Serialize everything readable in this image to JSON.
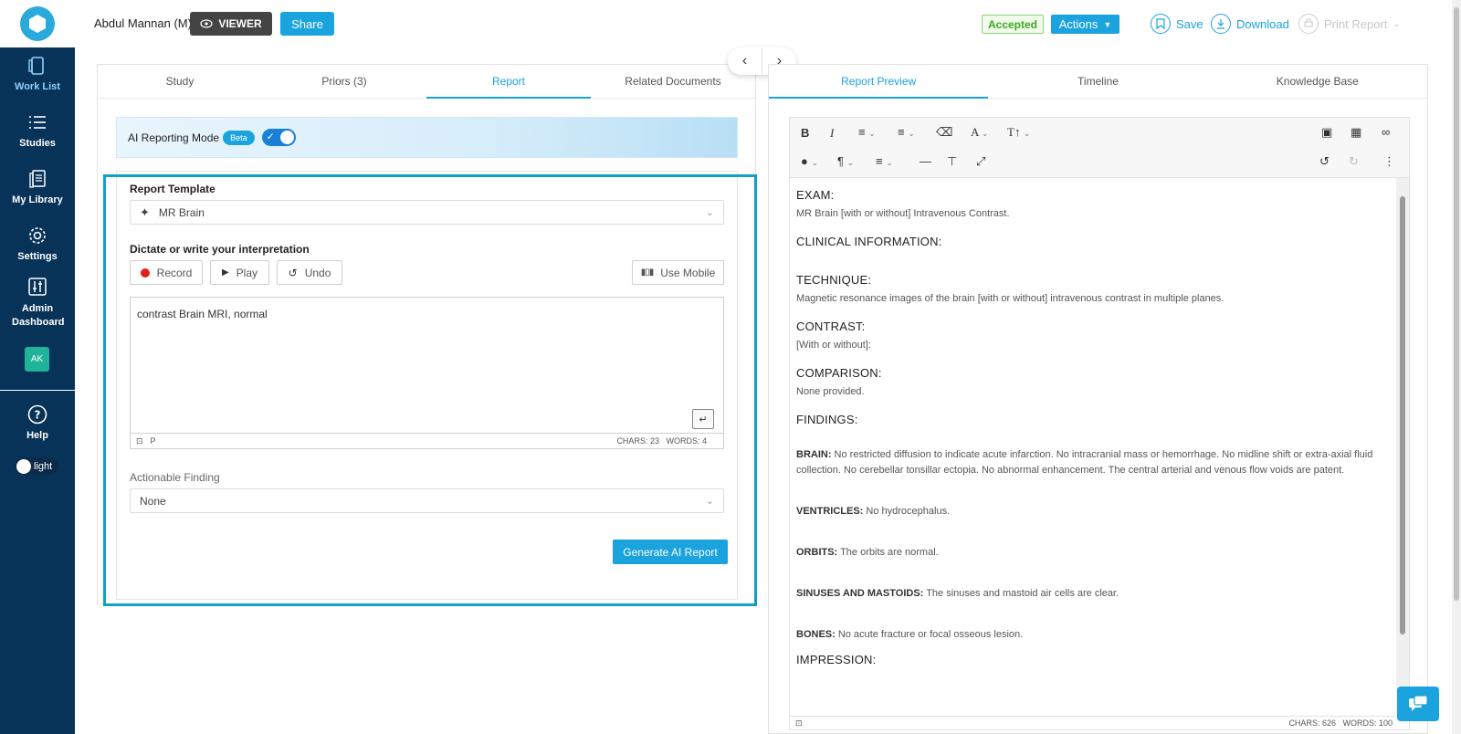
{
  "sidebar": {
    "items": [
      {
        "label": "Work List",
        "icon": "worklist-icon"
      },
      {
        "label": "Studies",
        "icon": "list-icon"
      },
      {
        "label": "My Library",
        "icon": "library-icon"
      },
      {
        "label": "Settings",
        "icon": "gear-icon"
      },
      {
        "label": "Admin Dashboard",
        "icon": "sliders-icon"
      }
    ],
    "avatar_initials": "AK",
    "help_label": "Help",
    "theme_label": "light"
  },
  "header": {
    "user_name": "Abdul Mannan (M)",
    "viewer_label": "VIEWER",
    "share_label": "Share",
    "status_badge": "Accepted",
    "actions_label": "Actions",
    "save_label": "Save",
    "download_label": "Download",
    "print_label": "Print Report"
  },
  "left_tabs": [
    "Study",
    "Priors (3)",
    "Report",
    "Related Documents"
  ],
  "right_tabs": [
    "Report Preview",
    "Timeline",
    "Knowledge Base"
  ],
  "ai_mode": {
    "label": "AI Reporting Mode",
    "badge": "Beta",
    "enabled": true
  },
  "form": {
    "template_label": "Report Template",
    "template_value": "MR Brain",
    "dictate_label": "Dictate or write your interpretation",
    "record_label": "Record",
    "play_label": "Play",
    "undo_label": "Undo",
    "mobile_label": "Use Mobile",
    "text_value": "contrast Brain MRI, normal",
    "status_tag": "P",
    "chars": "CHARS: 23",
    "words": "WORDS: 4",
    "actionable_label": "Actionable Finding",
    "actionable_value": "None",
    "generate_label": "Generate AI Report"
  },
  "report": {
    "exam_h": "EXAM:",
    "exam_t": "MR Brain [with or without] Intravenous Contrast.",
    "clinical_h": "CLINICAL INFORMATION:",
    "technique_h": "TECHNIQUE:",
    "technique_t": "Magnetic resonance images of the brain [with or without] intravenous contrast in multiple planes.",
    "contrast_h": "CONTRAST:",
    "contrast_t": "[With or without]:",
    "comparison_h": "COMPARISON:",
    "comparison_t": "None provided.",
    "findings_h": "FINDINGS:",
    "brain_k": "BRAIN:",
    "brain_t": " No restricted diffusion to indicate acute infarction. No intracranial mass or hemorrhage. No midline shift or extra-axial fluid collection. No cerebellar tonsillar ectopia. No abnormal enhancement. The central arterial and venous flow voids are patent.",
    "ventricles_k": "VENTRICLES:",
    "ventricles_t": " No hydrocephalus.",
    "orbits_k": "ORBITS:",
    "orbits_t": " The orbits are normal.",
    "sinuses_k": "SINUSES AND MASTOIDS:",
    "sinuses_t": " The sinuses and mastoid air cells are clear.",
    "bones_k": "BONES:",
    "bones_t": " No acute fracture or focal osseous lesion.",
    "impression_h": "IMPRESSION:",
    "chars": "CHARS: 626",
    "words": "WORDS: 100"
  },
  "colors": {
    "sidebar": "#083358",
    "accent": "#1aa3dd",
    "highlight": "#13a0c2",
    "accepted": "#3fa626"
  }
}
